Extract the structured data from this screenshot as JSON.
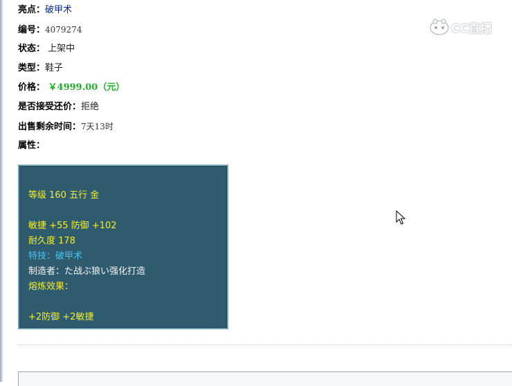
{
  "item_info": {
    "highlight": {
      "label": "亮点：",
      "value": "破甲术"
    },
    "serial": {
      "label": "编号：",
      "value": "4079274"
    },
    "status": {
      "label": "状态：",
      "value": " 上架中"
    },
    "type": {
      "label": "类型：",
      "value": "鞋子"
    },
    "price": {
      "label": "价格：",
      "value": " ￥4999.00（元）"
    },
    "counter_offer": {
      "label": "是否接受还价：",
      "value": "拒绝"
    },
    "time_remaining": {
      "label": "出售剩余时间：",
      "value": "7天13时"
    },
    "attributes": {
      "label": "属性："
    }
  },
  "attribute_panel": {
    "line1": "等级 160 五行 金",
    "line2": "敏捷 +55 防御 +102",
    "line3": "耐久度 178",
    "line4": "特技：破甲术",
    "line5": "制造者：た战ぶ狼い强化打造",
    "line6": "熔炼效果：",
    "line7": "+2防御 +2敏捷"
  },
  "watermark": {
    "text": "CC直播",
    "icon": "cc-live-logo-icon"
  },
  "colors": {
    "panel_bg": "#2f5b6e",
    "panel_border": "#6f9fb3",
    "yellow_text": "#f4ef2a",
    "cyan_text": "#4cc2f2",
    "price_green": "#22b02a",
    "link_blue": "#0a2a8c"
  }
}
